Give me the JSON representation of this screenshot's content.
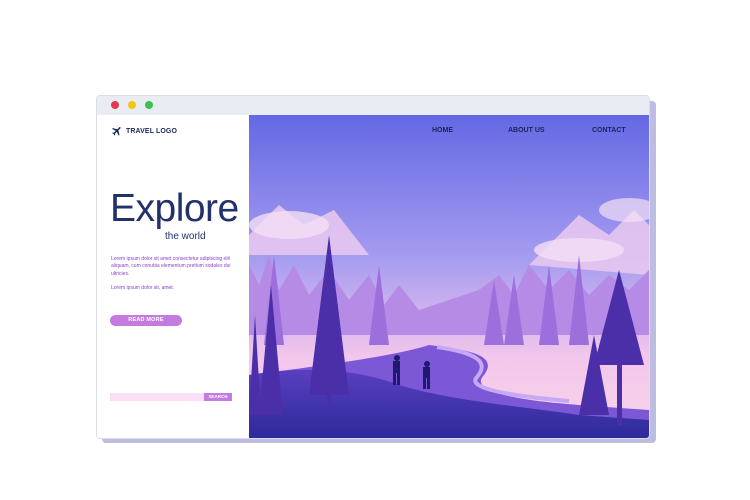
{
  "window": {
    "controls": [
      "close",
      "minimize",
      "maximize"
    ]
  },
  "brand": {
    "logo_text": "TRAVEL LOGO",
    "logo_icon": "airplane-icon"
  },
  "nav": {
    "home": "HOME",
    "about": "ABOUT US",
    "contact": "CONTACT"
  },
  "hero": {
    "headline": "Explore",
    "subheadline": "the world",
    "body": "Lorem ipsum dolor sit amet consectetur adipiscing elit aliquam, cum conubia elementum pretium sodales dui ultricies.",
    "body2": "Lorem ipsum dolor sit, amet.",
    "cta_label": "READ MORE"
  },
  "search": {
    "placeholder": "",
    "button_label": "SEARCH"
  },
  "colors": {
    "accent": "#c57ae0",
    "text_dark": "#23316b",
    "body_purple": "#8b3fd0",
    "sky_top": "#6a72e6",
    "sky_bottom": "#f2c8ee"
  }
}
